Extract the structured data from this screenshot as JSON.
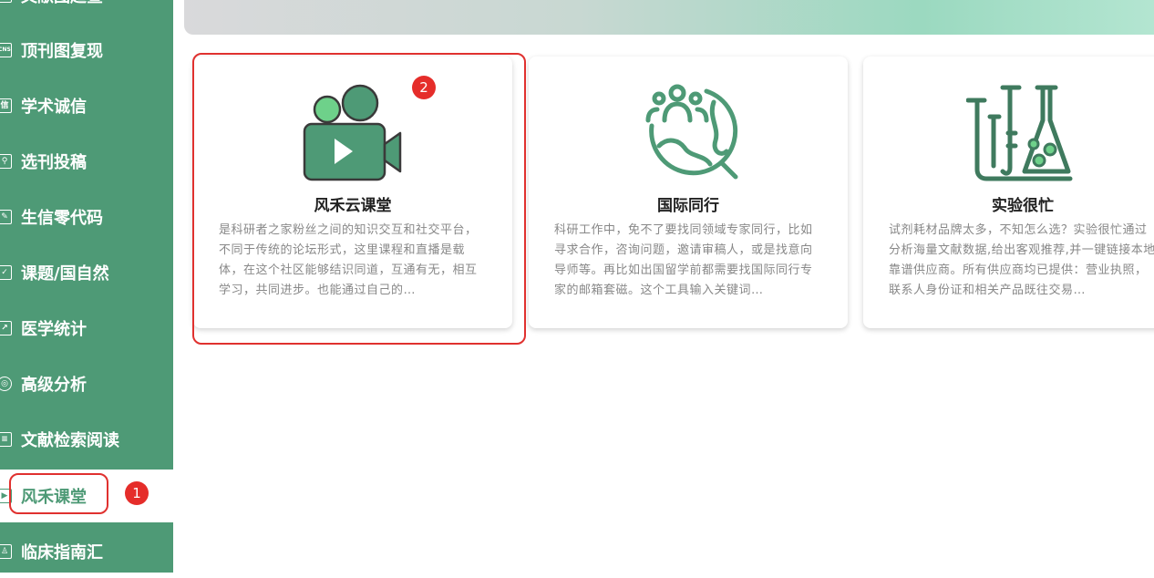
{
  "sidebar": {
    "items": [
      {
        "label": "文献图趋查",
        "icon": "chart-grid-icon"
      },
      {
        "label": "顶刊图复现",
        "icon": "cns-icon",
        "icon_text": "CNS"
      },
      {
        "label": "学术诚信",
        "icon": "integrity-icon",
        "icon_text": "信"
      },
      {
        "label": "选刊投稿",
        "icon": "search-icon"
      },
      {
        "label": "生信零代码",
        "icon": "edit-icon"
      },
      {
        "label": "课题/国自然",
        "icon": "project-icon"
      },
      {
        "label": "医学统计",
        "icon": "trend-chart-icon"
      },
      {
        "label": "高级分析",
        "icon": "brain-icon"
      },
      {
        "label": "文献检索阅读",
        "icon": "document-icon"
      },
      {
        "label": "风禾课堂",
        "icon": "video-play-icon"
      },
      {
        "label": "临床指南汇",
        "icon": "guide-icon"
      }
    ]
  },
  "cards": [
    {
      "title": "风禾云课堂",
      "icon": "video-camera-icon",
      "desc": "是科研者之家粉丝之间的知识交互和社交平台，不同于传统的论坛形式，这里课程和直播是载体，在这个社区能够结识同道，互通有无，相互学习，共同进步。也能通过自己的…"
    },
    {
      "title": "国际同行",
      "icon": "globe-people-icon",
      "desc": "科研工作中，免不了要找同领域专家同行，比如寻求合作，咨询问题，邀请审稿人，或是找意向导师等。再比如出国留学前都需要找国际同行专家的邮箱套磁。这个工具输入关键词…"
    },
    {
      "title": "实验很忙",
      "icon": "lab-flask-icon",
      "desc": "试剂耗材品牌太多，不知怎么选？实验很忙通过分析海量文献数据,给出客观推荐,并一键链接本地靠谱供应商。所有供应商均已提供：营业执照，联系人身份证和相关产品既往交易…"
    }
  ],
  "badges": {
    "first": "1",
    "second": "2"
  },
  "colors": {
    "sidebar": "#4e9a76",
    "icon_green": "#4e9a76",
    "highlight": "#e0312f"
  }
}
